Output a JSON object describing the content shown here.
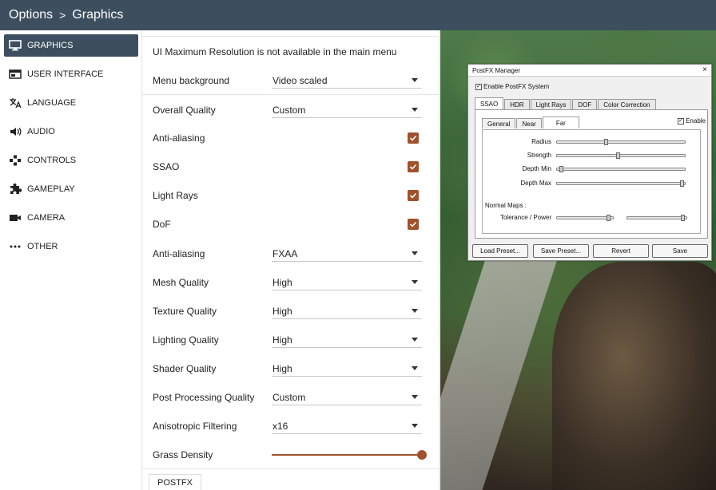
{
  "header": {
    "breadcrumb_root": "Options",
    "separator": ">",
    "breadcrumb_current": "Graphics"
  },
  "sidebar": {
    "items": [
      {
        "label": "GRAPHICS",
        "icon": "monitor-icon",
        "active": true
      },
      {
        "label": "USER INTERFACE",
        "icon": "window-icon",
        "active": false
      },
      {
        "label": "LANGUAGE",
        "icon": "translate-icon",
        "active": false
      },
      {
        "label": "AUDIO",
        "icon": "speaker-icon",
        "active": false
      },
      {
        "label": "CONTROLS",
        "icon": "gamepad-icon",
        "active": false
      },
      {
        "label": "GAMEPLAY",
        "icon": "puzzle-icon",
        "active": false
      },
      {
        "label": "CAMERA",
        "icon": "camera-icon",
        "active": false
      },
      {
        "label": "OTHER",
        "icon": "more-icon",
        "active": false
      }
    ]
  },
  "main": {
    "notice": "UI Maximum Resolution is not available in the main menu",
    "menu_background": {
      "label": "Menu background",
      "value": "Video scaled"
    },
    "overall_quality": {
      "label": "Overall Quality",
      "value": "Custom"
    },
    "anti_aliasing_toggle": {
      "label": "Anti-aliasing",
      "checked": true
    },
    "ssao": {
      "label": "SSAO",
      "checked": true
    },
    "light_rays": {
      "label": "Light Rays",
      "checked": true
    },
    "dof": {
      "label": "DoF",
      "checked": true
    },
    "anti_aliasing": {
      "label": "Anti-aliasing",
      "value": "FXAA"
    },
    "mesh_quality": {
      "label": "Mesh Quality",
      "value": "High"
    },
    "texture_quality": {
      "label": "Texture Quality",
      "value": "High"
    },
    "lighting_quality": {
      "label": "Lighting Quality",
      "value": "High"
    },
    "shader_quality": {
      "label": "Shader Quality",
      "value": "High"
    },
    "post_processing_quality": {
      "label": "Post Processing Quality",
      "value": "Custom"
    },
    "anisotropic_filtering": {
      "label": "Anisotropic Filtering",
      "value": "x16"
    },
    "grass_density": {
      "label": "Grass Density",
      "value": 1.0
    },
    "postfx_tab": "POSTFX"
  },
  "postfx": {
    "title": "PostFX Manager",
    "close": "×",
    "enable_system": "Enable PostFX System",
    "tabs": [
      "SSAO",
      "HDR",
      "Light Rays",
      "DOF",
      "Color Correction"
    ],
    "active_tab": "SSAO",
    "subtabs": [
      "General",
      "Near",
      "Far"
    ],
    "active_subtab": "Far",
    "enable": "Enable",
    "params": {
      "radius": {
        "label": "Radius",
        "value": 0.38
      },
      "strength": {
        "label": "Strength",
        "value": 0.48
      },
      "depth_min": {
        "label": "Depth Min",
        "value": 0.02
      },
      "depth_max": {
        "label": "Depth Max",
        "value": 1.0
      }
    },
    "normal_maps": "Normal Maps :",
    "tolerance_power": {
      "label": "Tolerance / Power",
      "tolerance": 0.97,
      "power": 0.98
    },
    "buttons": {
      "load": "Load Preset...",
      "save_preset": "Save Preset...",
      "revert": "Revert",
      "save": "Save"
    }
  },
  "colors": {
    "header_bg": "#3d4f5e",
    "accent": "#a0522d"
  }
}
